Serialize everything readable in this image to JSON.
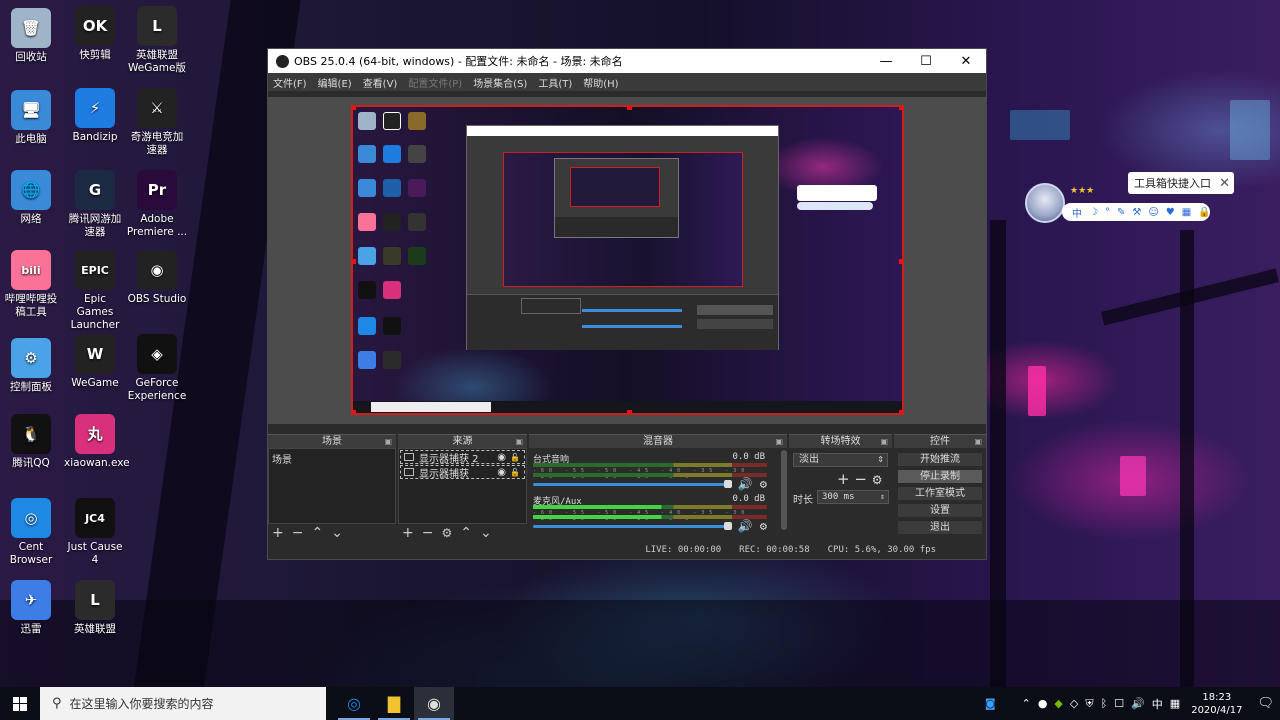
{
  "desktop": {
    "icons": [
      {
        "label": "回收站",
        "icon": "recycle-bin-icon",
        "color": "#9fb4c8",
        "glyph": "🗑"
      },
      {
        "label": "此电脑",
        "icon": "this-pc-icon",
        "color": "#3a8ad8",
        "glyph": "🖥"
      },
      {
        "label": "网络",
        "icon": "network-icon",
        "color": "#3a8ad8",
        "glyph": "🌐"
      },
      {
        "label": "哔哩哔哩投稿工具",
        "icon": "bilibili-icon",
        "color": "#fb7299",
        "glyph": "bili"
      },
      {
        "label": "控制面板",
        "icon": "control-panel-icon",
        "color": "#4aa3e6",
        "glyph": "⚙"
      },
      {
        "label": "腾讯QQ",
        "icon": "qq-icon",
        "color": "#111",
        "glyph": "🐧"
      },
      {
        "label": "Cent Browser",
        "icon": "cent-browser-icon",
        "color": "#1e88e5",
        "glyph": "◎"
      },
      {
        "label": "迅雷",
        "icon": "xunlei-icon",
        "color": "#3c7de6",
        "glyph": "✈"
      },
      {
        "label": "快剪辑",
        "icon": "kuaijianji-icon",
        "color": "#222",
        "glyph": "OK"
      },
      {
        "label": "Bandizip",
        "icon": "bandizip-icon",
        "color": "#1e7be0",
        "glyph": "⚡"
      },
      {
        "label": "腾讯网游加速器",
        "icon": "tencent-accelerator-icon",
        "color": "#1d2a44",
        "glyph": "G"
      },
      {
        "label": "Epic Games Launcher",
        "icon": "epic-games-icon",
        "color": "#222",
        "glyph": "EPIC"
      },
      {
        "label": "WeGame",
        "icon": "wegame-icon",
        "color": "#222",
        "glyph": "W"
      },
      {
        "label": "xiaowan.exe",
        "icon": "xiaowan-icon",
        "color": "#d8307a",
        "glyph": "丸"
      },
      {
        "label": "Just Cause 4",
        "icon": "just-cause-icon",
        "color": "#111",
        "glyph": "JC4"
      },
      {
        "label": "英雄联盟",
        "icon": "lol-icon",
        "color": "#2b2b2b",
        "glyph": "L"
      },
      {
        "label": "英雄联盟WeGame版",
        "icon": "lol-wegame-icon",
        "color": "#2b2b2b",
        "glyph": "L"
      },
      {
        "label": "奇游电竞加速器",
        "icon": "qiyou-icon",
        "color": "#222",
        "glyph": "⚔"
      },
      {
        "label": "Adobe Premiere ...",
        "icon": "premiere-icon",
        "color": "#2a0a3a",
        "glyph": "Pr"
      },
      {
        "label": "OBS Studio",
        "icon": "obs-icon",
        "color": "#222",
        "glyph": "◉"
      },
      {
        "label": "GeForce Experience",
        "icon": "geforce-icon",
        "color": "#111",
        "glyph": "◈"
      }
    ]
  },
  "obs": {
    "title": "OBS 25.0.4 (64-bit, windows) - 配置文件: 未命名 - 场景: 未命名",
    "menu": [
      {
        "label": "文件(F)",
        "disabled": false
      },
      {
        "label": "编辑(E)",
        "disabled": false
      },
      {
        "label": "查看(V)",
        "disabled": false
      },
      {
        "label": "配置文件(P)",
        "disabled": true
      },
      {
        "label": "场景集合(S)",
        "disabled": false
      },
      {
        "label": "工具(T)",
        "disabled": false
      },
      {
        "label": "帮助(H)",
        "disabled": false
      }
    ],
    "docks": {
      "scenes": {
        "title": "场景",
        "items": [
          "场景"
        ]
      },
      "sources": {
        "title": "来源",
        "items": [
          "显示器捕获 2",
          "显示器捕获"
        ]
      },
      "mixer": {
        "title": "混音器",
        "tracks": [
          {
            "name": "台式音响",
            "db": "0.0 dB",
            "active": false
          },
          {
            "name": "麦克风/Aux",
            "db": "0.0 dB",
            "active": true
          }
        ],
        "scale": "-60 -55 -50 -45 -40 -35 -30 -25 -20 -15 -10 -5 0"
      },
      "transitions": {
        "title": "转场特效",
        "type": "淡出",
        "duration_label": "时长",
        "duration": "300 ms"
      },
      "controls": {
        "title": "控件",
        "buttons": [
          "开始推流",
          "停止录制",
          "工作室模式",
          "设置",
          "退出"
        ],
        "active_index": 1
      }
    },
    "status": {
      "live": "LIVE: 00:00:00",
      "rec": "REC: 00:00:58",
      "cpu": "CPU: 5.6%, 30.00 fps"
    }
  },
  "widget": {
    "tip": "工具箱快捷入口",
    "bar_items": [
      "中",
      "☽",
      "°",
      "✎",
      "⚒",
      "☺",
      "♥",
      "▦",
      "🔒"
    ],
    "stars": "★★★"
  },
  "taskbar": {
    "search_placeholder": "在这里输入你要搜索的内容",
    "apps": [
      {
        "name": "cent-browser",
        "color": "#1e88e5",
        "glyph": "◎",
        "active": false
      },
      {
        "name": "file-explorer",
        "color": "#f2c230",
        "glyph": "▇",
        "active": false
      },
      {
        "name": "obs",
        "color": "#ddd",
        "glyph": "◉",
        "active": true
      }
    ],
    "time": "18:23",
    "date": "2020/4/17"
  }
}
